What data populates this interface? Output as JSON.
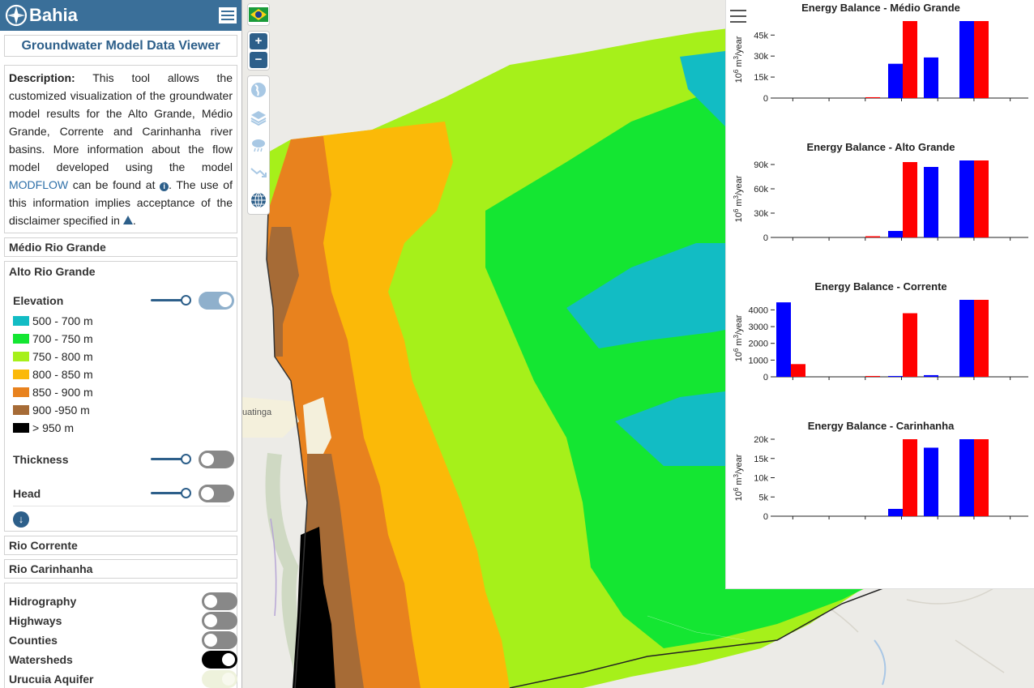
{
  "header": {
    "app_name": "Bahia",
    "menu_icon": "hamburger-icon"
  },
  "app_title": "Groundwater Model Data Viewer",
  "description": {
    "label": "Description:",
    "text1": " This tool allows the customized visualization of the groundwater model results for the Alto Grande, Médio Grande, Corrente and Carinhanha river basins. More information about the flow model developed using the model ",
    "link": "MODFLOW",
    "text2": " can be found at ",
    "text3": ". The use of this information implies acceptance of the disclaimer specified in ",
    "text4": "."
  },
  "basins": {
    "medio": "Médio Rio Grande",
    "alto": "Alto Rio Grande",
    "corrente": "Rio Corrente",
    "carinhanha": "Rio Carinhanha"
  },
  "alto_layers": {
    "elevation": {
      "label": "Elevation",
      "opacity": 1.0,
      "enabled": true
    },
    "thickness": {
      "label": "Thickness",
      "opacity": 1.0,
      "enabled": false
    },
    "head": {
      "label": "Head",
      "opacity": 1.0,
      "enabled": false
    }
  },
  "elevation_legend": [
    {
      "label": "500 - 700 m",
      "color": "#12bcc4"
    },
    {
      "label": "700 - 750 m",
      "color": "#14e632"
    },
    {
      "label": "750 - 800 m",
      "color": "#a6f01a"
    },
    {
      "label": "800 - 850 m",
      "color": "#fbb908"
    },
    {
      "label": "850 - 900 m",
      "color": "#e8821e"
    },
    {
      "label": "900 -950 m",
      "color": "#a66b36"
    },
    {
      "label": "> 950 m",
      "color": "#000000"
    }
  ],
  "overlays": [
    {
      "label": "Hidrography",
      "state": "off"
    },
    {
      "label": "Highways",
      "state": "off"
    },
    {
      "label": "Counties",
      "state": "off"
    },
    {
      "label": "Watersheds",
      "state": "on"
    },
    {
      "label": "Urucuia Aquifer",
      "state": "disabled"
    }
  ],
  "map": {
    "place_label": "uatinga",
    "zoom_in": "+",
    "zoom_out": "−",
    "colors": {
      "map_bg": "#ecebe7",
      "accent": "#2d5f8a"
    }
  },
  "chart_data": [
    {
      "type": "bar",
      "title": "Energy Balance - Médio Grande",
      "ylabel_base": "10",
      "ylabel_exp": "6",
      "ylabel_unit": " m",
      "ylabel_unit_exp": "3",
      "ylabel_tail": "/year",
      "ylim": [
        0,
        55000
      ],
      "ticks": [
        0,
        15000,
        30000,
        45000
      ],
      "tick_labels": [
        "0",
        "15k",
        "30k",
        "45k"
      ],
      "series": [
        {
          "color": "#0000ff",
          "values": [
            0,
            0,
            0,
            24500,
            29000,
            55000
          ]
        },
        {
          "color": "#ff0000",
          "values": [
            0,
            0,
            600,
            55000,
            0,
            55000
          ]
        }
      ]
    },
    {
      "type": "bar",
      "title": "Energy Balance - Alto Grande",
      "ylabel_base": "10",
      "ylabel_exp": "6",
      "ylabel_unit": " m",
      "ylabel_unit_exp": "3",
      "ylabel_tail": "/year",
      "ylim": [
        0,
        95000
      ],
      "ticks": [
        0,
        30000,
        60000,
        90000
      ],
      "tick_labels": [
        "0",
        "30k",
        "60k",
        "90k"
      ],
      "series": [
        {
          "color": "#0000ff",
          "values": [
            0,
            0,
            0,
            8000,
            87000,
            95000
          ]
        },
        {
          "color": "#ff0000",
          "values": [
            0,
            0,
            1500,
            93000,
            0,
            95000
          ]
        }
      ]
    },
    {
      "type": "bar",
      "title": "Energy Balance - Corrente",
      "ylabel_base": "10",
      "ylabel_exp": "6",
      "ylabel_unit": " m",
      "ylabel_unit_exp": "3",
      "ylabel_tail": "/year",
      "ylim": [
        0,
        4600
      ],
      "ticks": [
        0,
        1000,
        2000,
        3000,
        4000
      ],
      "tick_labels": [
        "0",
        "1000",
        "2000",
        "3000",
        "4000"
      ],
      "series": [
        {
          "color": "#0000ff",
          "values": [
            4450,
            0,
            0,
            50,
            100,
            4600
          ]
        },
        {
          "color": "#ff0000",
          "values": [
            760,
            0,
            50,
            3800,
            0,
            4600
          ]
        }
      ]
    },
    {
      "type": "bar",
      "title": "Energy Balance - Carinhanha",
      "ylabel_base": "10",
      "ylabel_exp": "6",
      "ylabel_unit": " m",
      "ylabel_unit_exp": "3",
      "ylabel_tail": "/year",
      "ylim": [
        0,
        20000
      ],
      "ticks": [
        0,
        5000,
        10000,
        15000,
        20000
      ],
      "tick_labels": [
        "0",
        "5k",
        "10k",
        "15k",
        "20k"
      ],
      "series": [
        {
          "color": "#0000ff",
          "values": [
            0,
            0,
            0,
            1900,
            17800,
            20000
          ]
        },
        {
          "color": "#ff0000",
          "values": [
            0,
            0,
            0,
            20000,
            0,
            20000
          ]
        }
      ]
    }
  ]
}
